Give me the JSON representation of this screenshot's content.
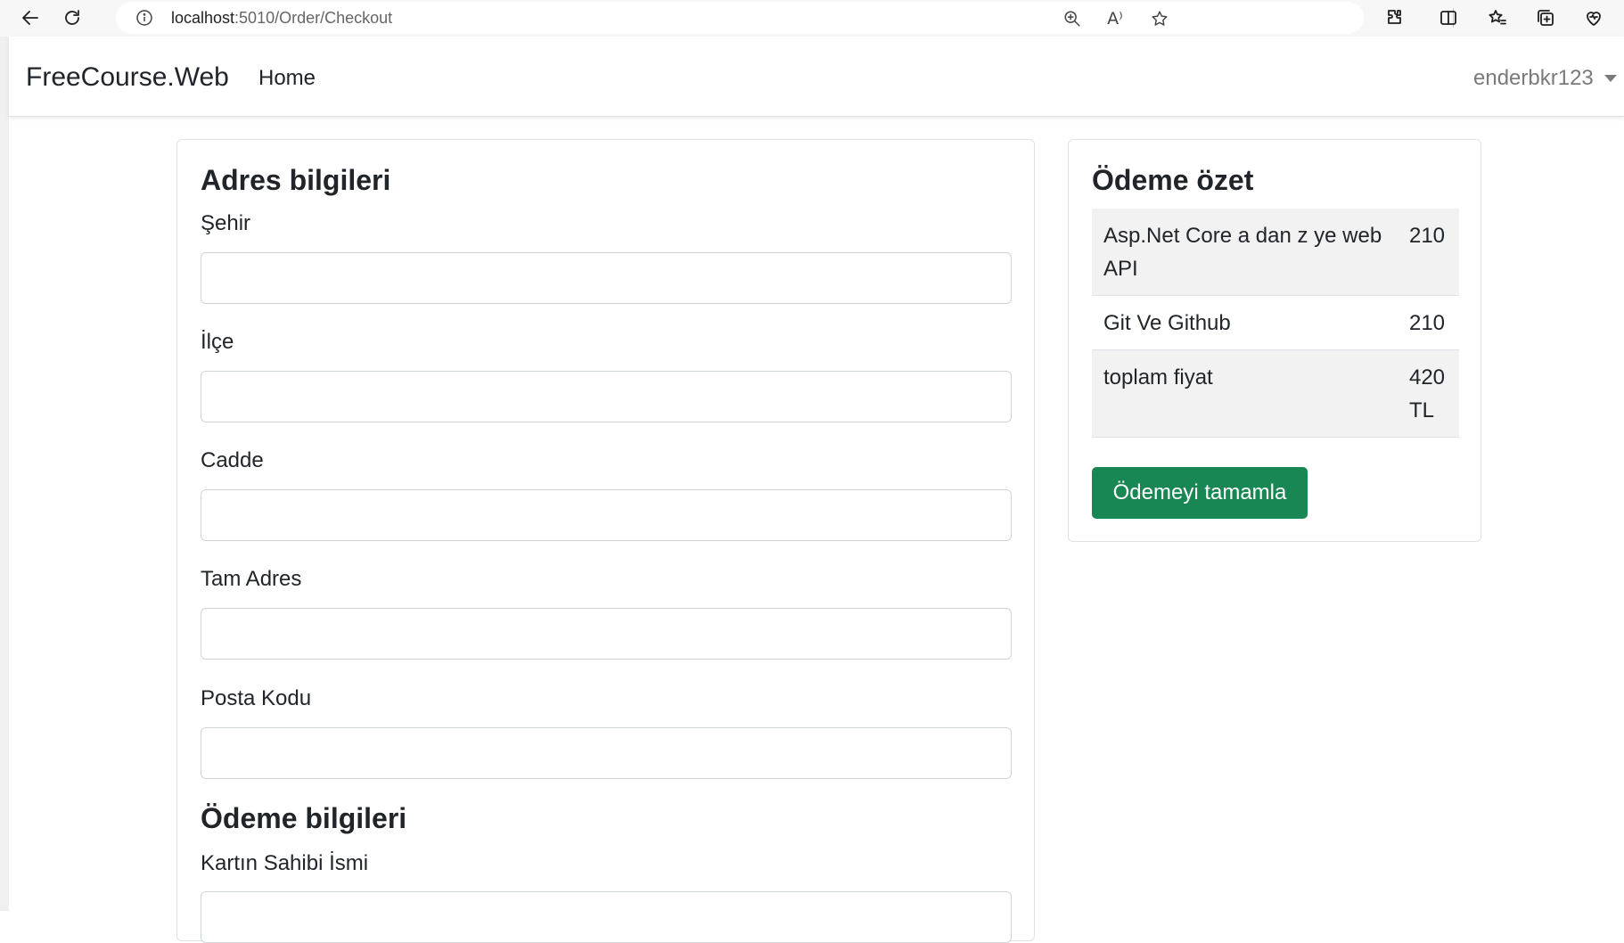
{
  "browser": {
    "url_host": "localhost",
    "url_path": ":5010/Order/Checkout",
    "icons": [
      "back-arrow-icon",
      "refresh-icon",
      "site-info-icon",
      "zoom-icon",
      "read-aloud-icon",
      "favorite-star-icon",
      "extensions-icon",
      "split-screen-icon",
      "favorites-icon",
      "collections-icon",
      "browser-essentials-icon"
    ],
    "read_aloud_glyph": "A⁾"
  },
  "navbar": {
    "brand": "FreeCourse.Web",
    "home": "Home",
    "user": "enderbkr123"
  },
  "address_form": {
    "title": "Adres bilgileri",
    "fields": [
      {
        "label": "Şehir",
        "value": ""
      },
      {
        "label": "İlçe",
        "value": ""
      },
      {
        "label": "Cadde",
        "value": ""
      },
      {
        "label": "Tam Adres",
        "value": ""
      },
      {
        "label": "Posta Kodu",
        "value": ""
      }
    ]
  },
  "payment_form": {
    "title": "Ödeme bilgileri",
    "fields": [
      {
        "label": "Kartın Sahibi İsmi",
        "value": ""
      }
    ]
  },
  "summary": {
    "title": "Ödeme özet",
    "items": [
      {
        "name": "Asp.Net Core a dan z ye web API",
        "price": "210"
      },
      {
        "name": "Git Ve Github",
        "price": "210"
      }
    ],
    "total_label": "toplam fiyat",
    "total_value": "420 TL",
    "button": "Ödemeyi tamamla"
  },
  "colors": {
    "accent_button": "#198754",
    "striped_row": "#f2f2f2",
    "border": "#dee2e6"
  }
}
